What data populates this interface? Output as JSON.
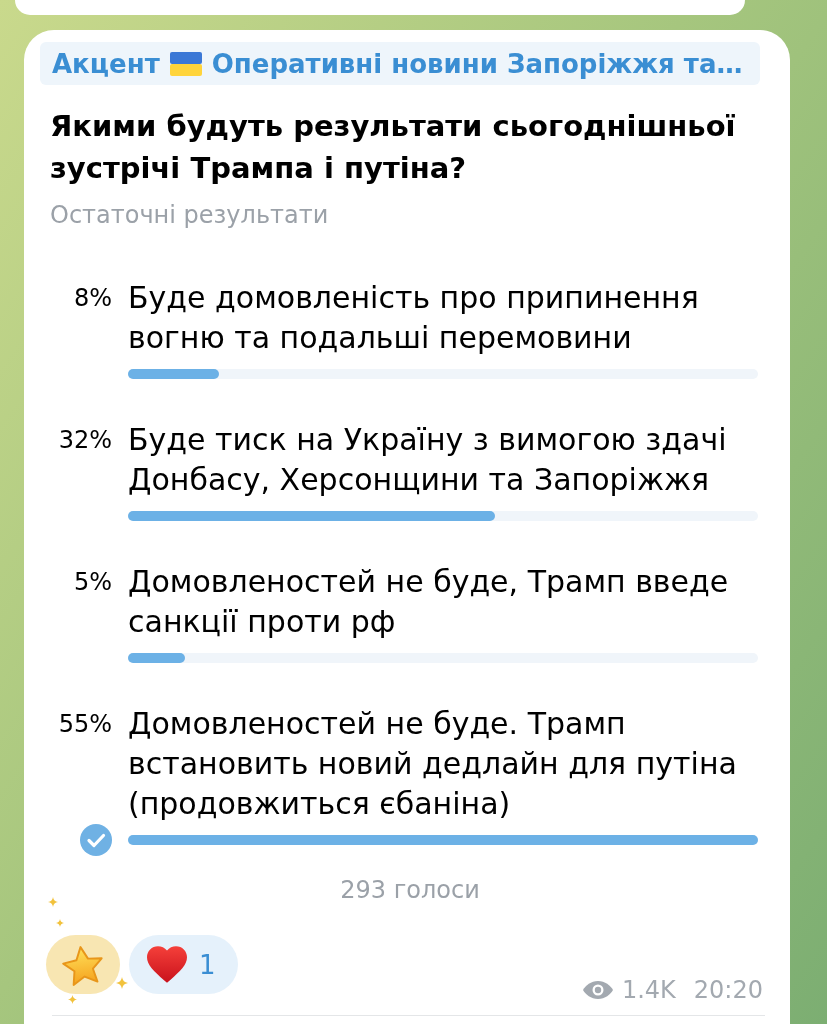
{
  "sender": {
    "name": "Акцент",
    "channel": "Оперативні новини Запоріжжя та…"
  },
  "poll": {
    "question": "Якими будуть результати сьогоднішньої зустрічі Трампа і путіна?",
    "status": "Остаточні результати",
    "options": [
      {
        "percent": "8%",
        "text": "Буде домовленість про припинення вогню та подальші перемовини",
        "level": 0.145,
        "selected": false
      },
      {
        "percent": "32%",
        "text": "Буде тиск на Україну з вимогою здачі Донбасу, Херсонщини та Запоріжжя",
        "level": 0.582,
        "selected": false
      },
      {
        "percent": "5%",
        "text": "Домовленостей не буде, Трамп введе санкції проти рф",
        "level": 0.091,
        "selected": false
      },
      {
        "percent": "55%",
        "text": "Домовленостей не буде. Трамп встановить новий дедлайн для путіна (продовжиться єбаніна)",
        "level": 1.0,
        "selected": true
      }
    ],
    "votes": "293 голоси"
  },
  "reactions": [
    {
      "kind": "star"
    },
    {
      "kind": "heart",
      "count": "1"
    }
  ],
  "views": "1.4K",
  "time": "20:20"
}
